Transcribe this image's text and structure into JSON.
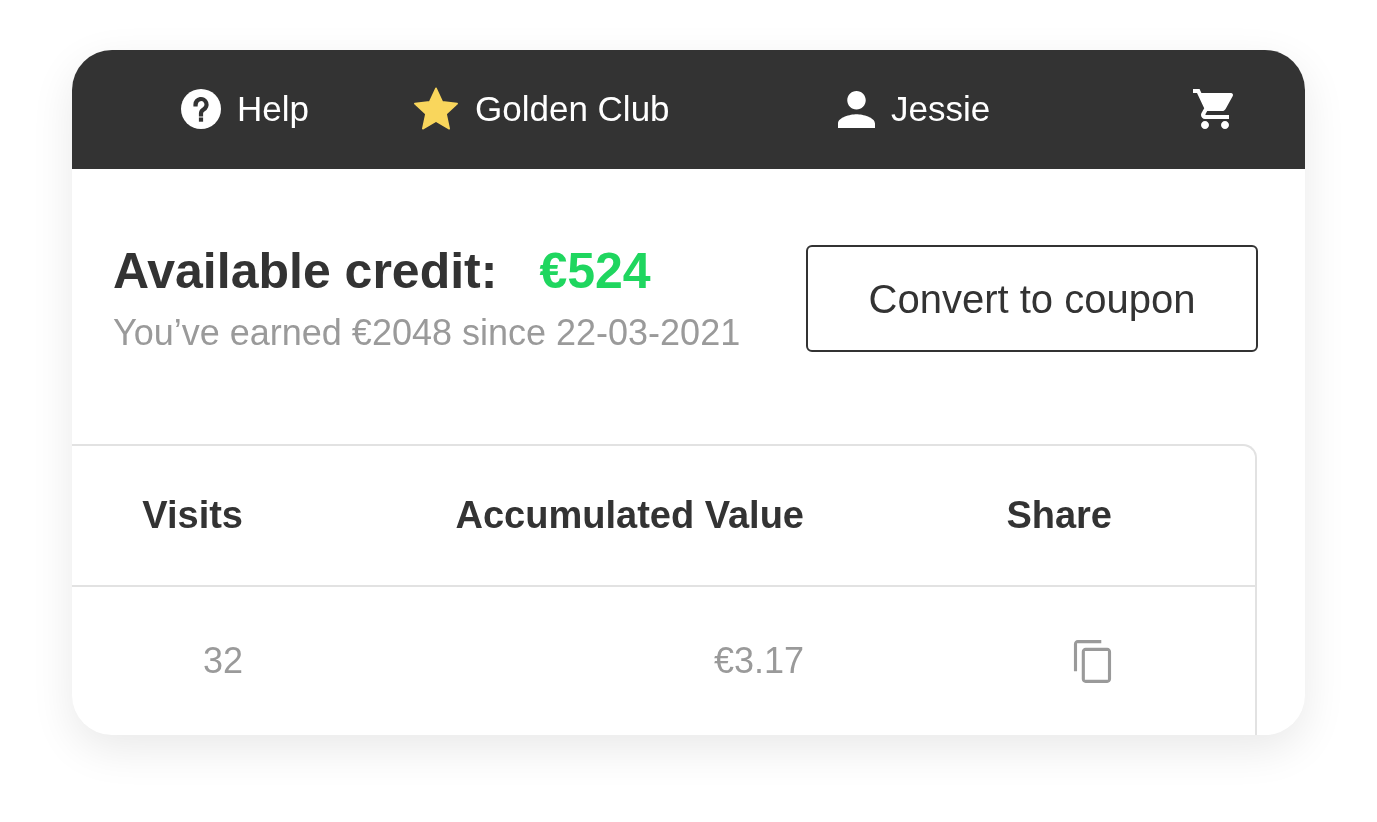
{
  "nav": [
    {
      "kind": "help",
      "label": "Help"
    },
    {
      "kind": "star",
      "label": "Golden Club"
    },
    {
      "kind": "user",
      "label": "Jessie"
    },
    {
      "kind": "cart"
    }
  ],
  "credit": {
    "title": "Available credit:",
    "amount": "€524",
    "note": "You’ve earned €2048 since 22-03-2021"
  },
  "convert_button": "Convert to coupon",
  "table": {
    "columns": [
      "Visits",
      "Accumulated Value",
      "Share"
    ],
    "rows": [
      {
        "cells": [
          {
            "kind": "text",
            "text": "32"
          },
          {
            "kind": "text",
            "text": "€3.17"
          },
          {
            "kind": "copy"
          }
        ]
      }
    ]
  }
}
